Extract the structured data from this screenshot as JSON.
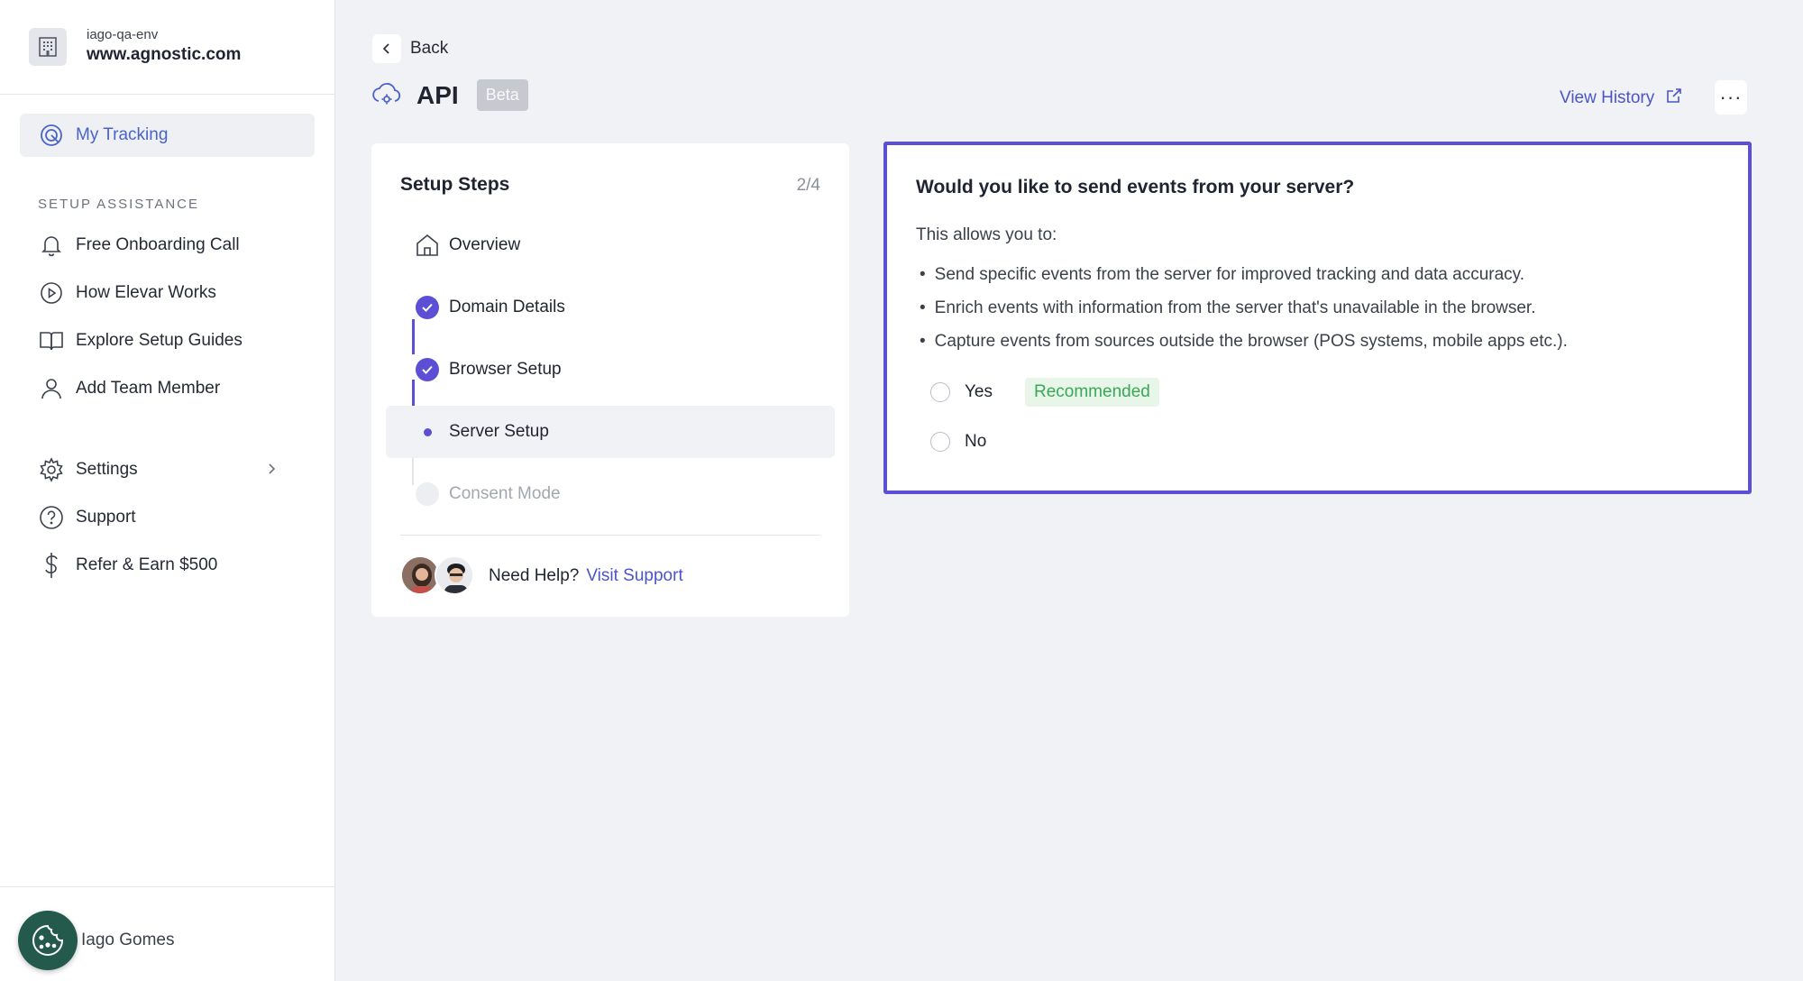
{
  "org": {
    "env": "iago-qa-env",
    "domain": "www.agnostic.com"
  },
  "sidebar": {
    "primary": {
      "label": "My Tracking"
    },
    "section_label": "SETUP ASSISTANCE",
    "assist_items": [
      {
        "label": "Free Onboarding Call",
        "icon": "bell-icon"
      },
      {
        "label": "How Elevar Works",
        "icon": "play-circle-icon"
      },
      {
        "label": "Explore Setup Guides",
        "icon": "book-icon"
      },
      {
        "label": "Add Team Member",
        "icon": "user-icon"
      }
    ],
    "bottom_items": [
      {
        "label": "Settings",
        "icon": "gear-icon"
      },
      {
        "label": "Support",
        "icon": "help-circle-icon"
      },
      {
        "label": "Refer & Earn $500",
        "icon": "dollar-icon"
      }
    ],
    "user_name": "Iago Gomes"
  },
  "header": {
    "back_label": "Back",
    "title": "API",
    "badge": "Beta",
    "view_history": "View History",
    "more": "···"
  },
  "steps": {
    "title": "Setup Steps",
    "count": "2/4",
    "items": [
      {
        "label": "Overview",
        "state": "home"
      },
      {
        "label": "Domain Details",
        "state": "done"
      },
      {
        "label": "Browser Setup",
        "state": "done"
      },
      {
        "label": "Server Setup",
        "state": "current"
      },
      {
        "label": "Consent Mode",
        "state": "future"
      }
    ],
    "help_text": "Need Help?",
    "help_link": "Visit Support"
  },
  "question": {
    "title": "Would you like to send events from your server?",
    "intro": "This allows you to:",
    "bullets": [
      "Send specific events from the server for improved tracking and data accuracy.",
      "Enrich events with information from the server that's unavailable in the browser.",
      "Capture events from sources outside the browser (POS systems, mobile apps etc.)."
    ],
    "options": [
      {
        "label": "Yes",
        "badge": "Recommended"
      },
      {
        "label": "No"
      }
    ]
  },
  "colors": {
    "accent": "#5b4fd6",
    "link": "#4a55c9",
    "recommended": "#3aa856"
  }
}
